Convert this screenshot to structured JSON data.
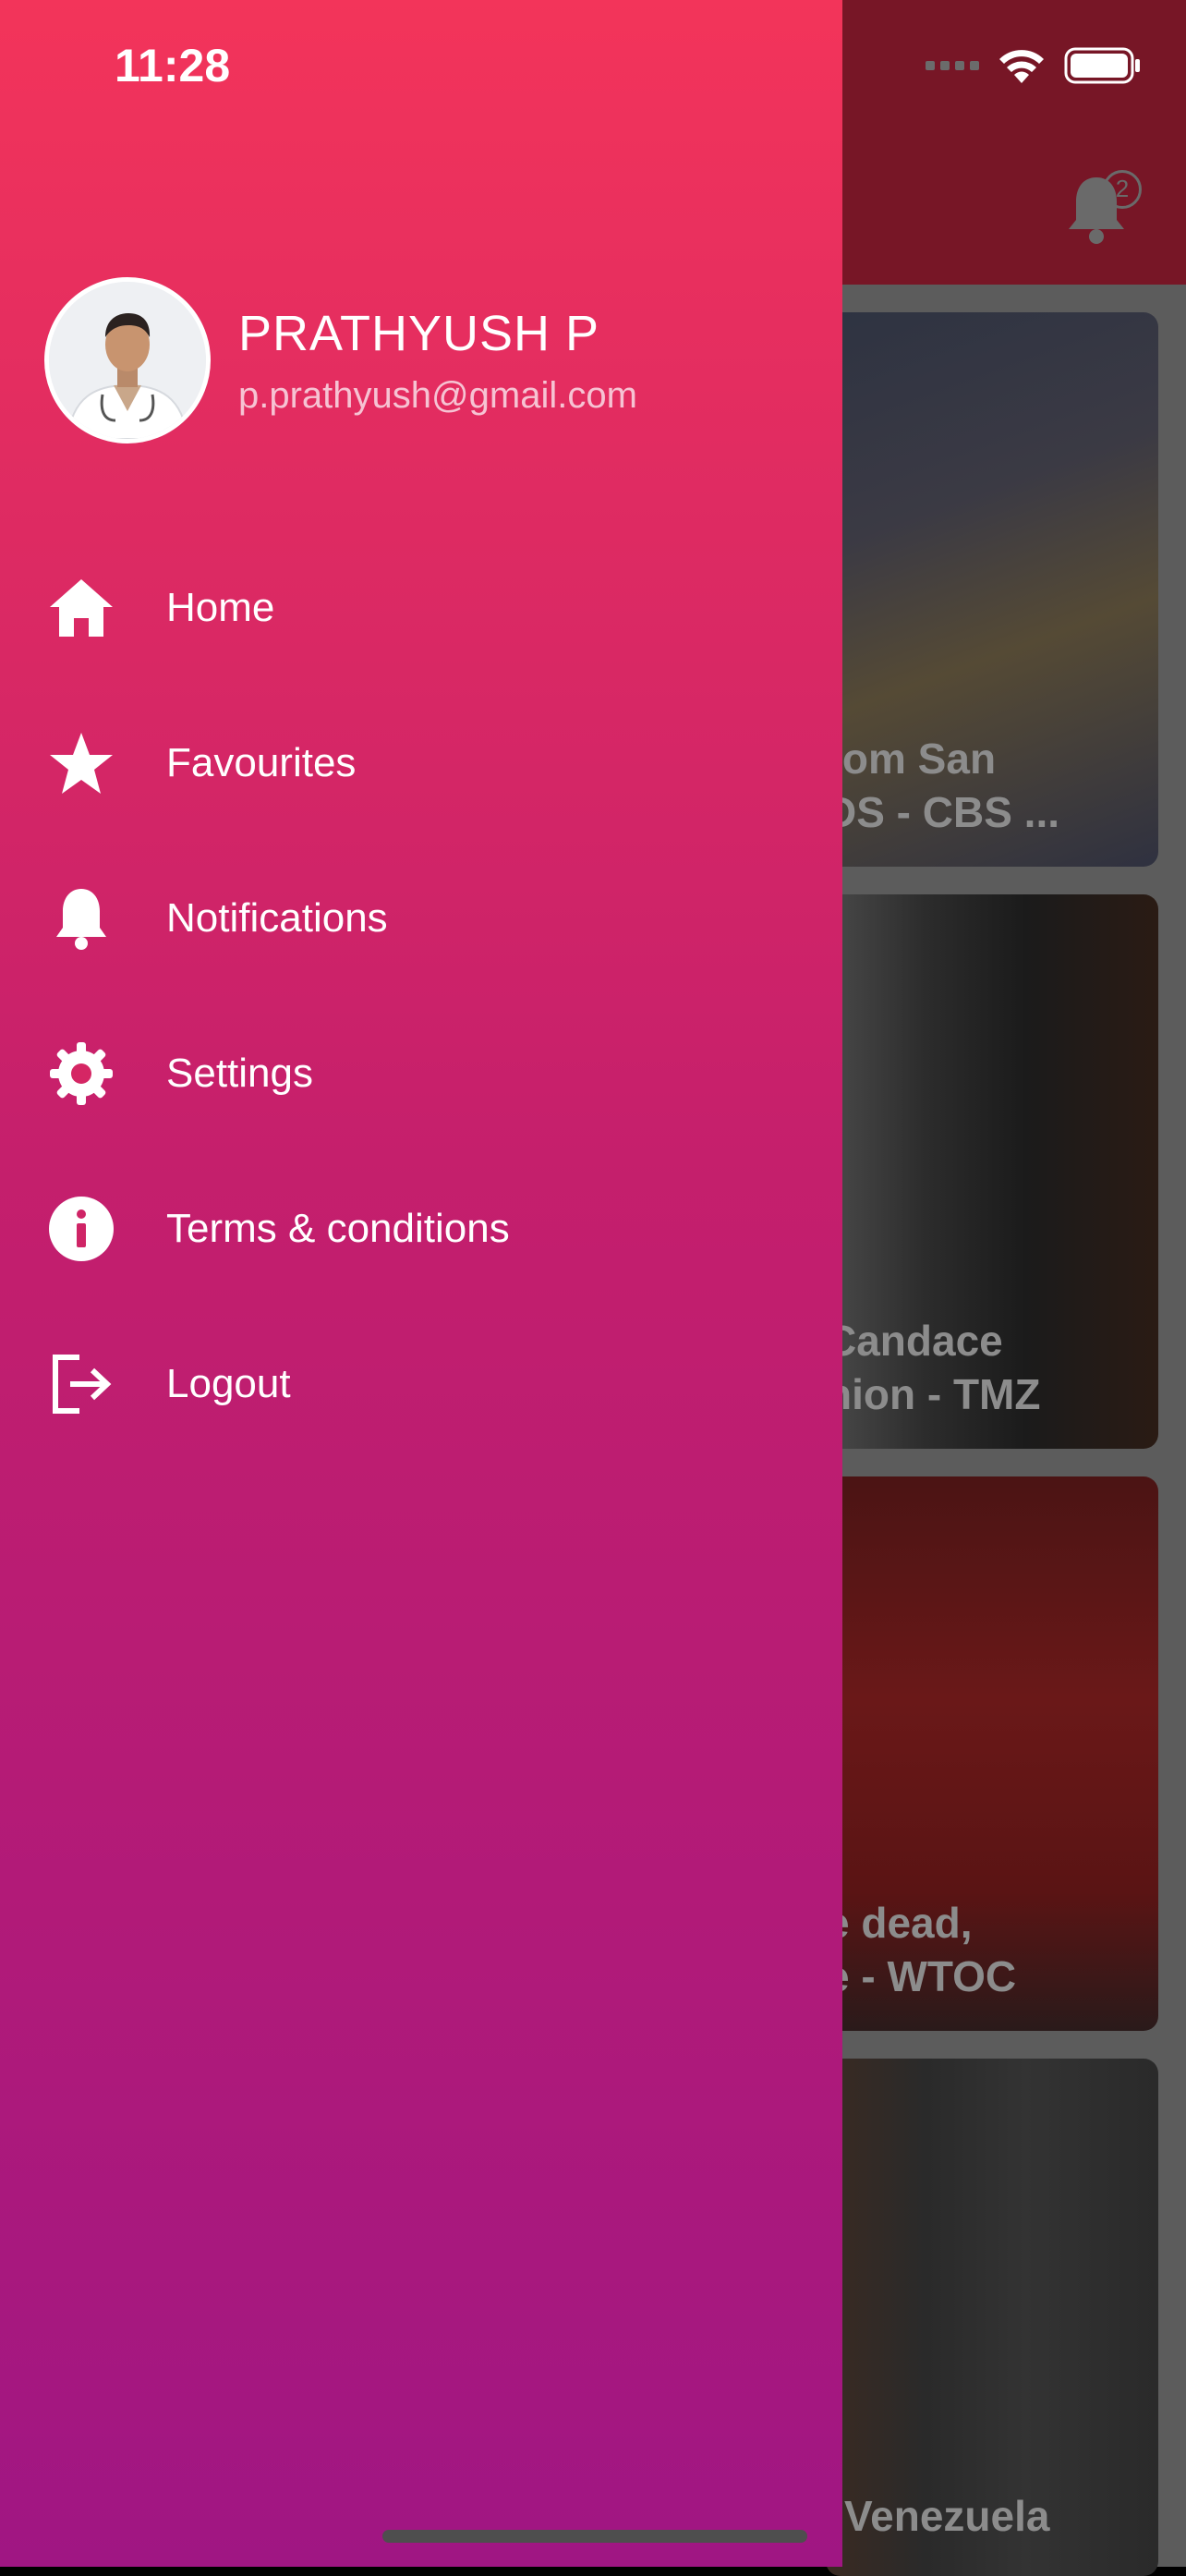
{
  "status_bar": {
    "time": "11:28"
  },
  "profile": {
    "name": "PRATHYUSH P",
    "email": "p.prathyush@gmail.com"
  },
  "menu": [
    {
      "label": "Home",
      "icon": "home-icon"
    },
    {
      "label": "Favourites",
      "icon": "star-icon"
    },
    {
      "label": "Notifications",
      "icon": "bell-icon"
    },
    {
      "label": "Settings",
      "icon": "gear-icon"
    },
    {
      "label": "Terms & conditions",
      "icon": "info-icon"
    },
    {
      "label": "Logout",
      "icon": "logout-icon"
    }
  ],
  "background": {
    "notification_count": "2",
    "cards": [
      {
        "line1": "rom San",
        "line2": "DS - CBS ..."
      },
      {
        "line1": "Candace",
        "line2": "nion - TMZ"
      },
      {
        "line1": "e dead,",
        "line2": "e - WTOC"
      },
      {
        "line1": "",
        "line2": "Venezuela"
      }
    ]
  },
  "colors": {
    "drawer_top": "#f3345a",
    "drawer_bottom": "#a01683",
    "header_bg": "#771626"
  }
}
